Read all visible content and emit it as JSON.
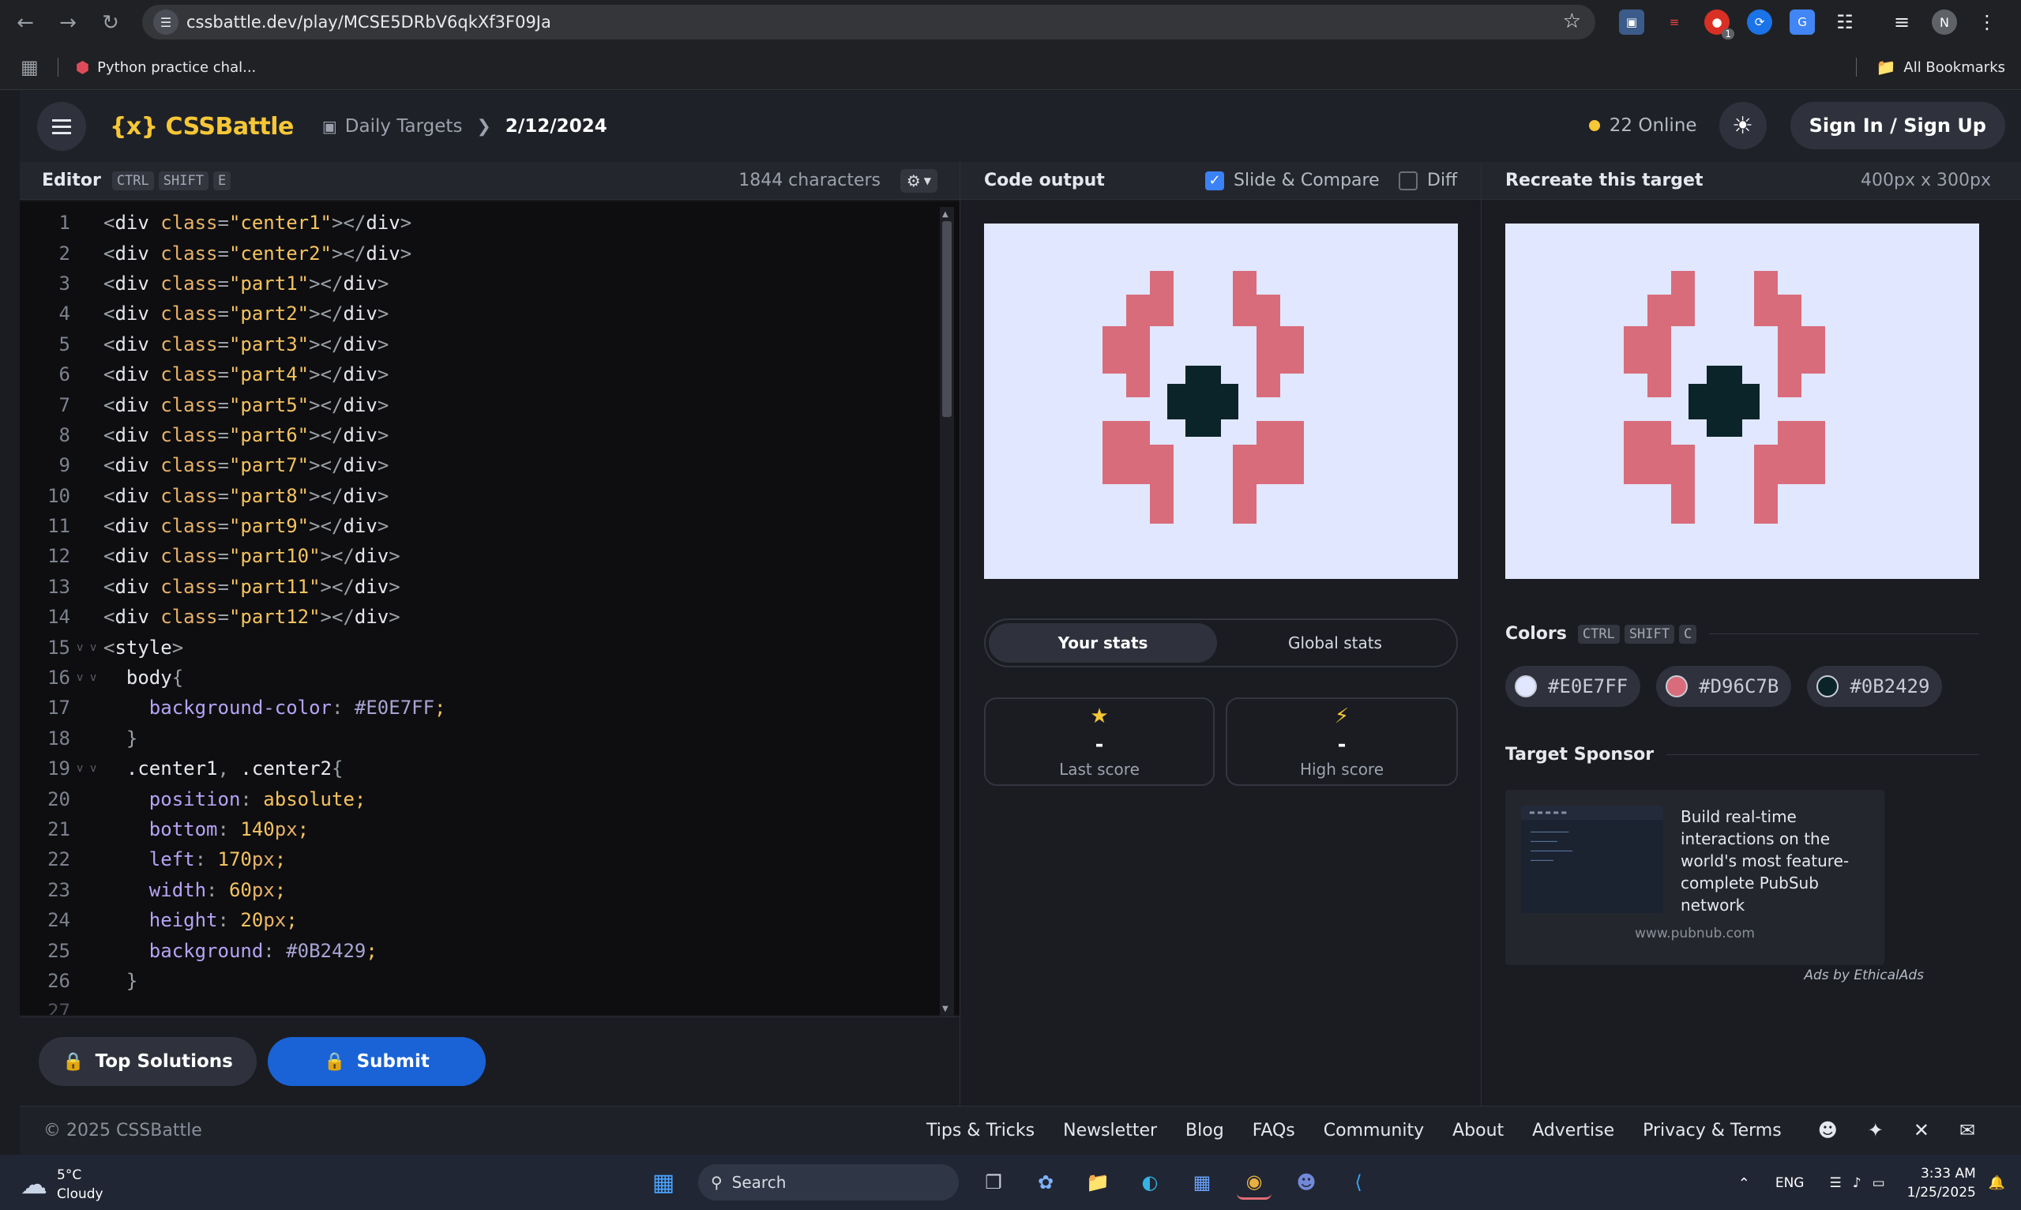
{
  "browser": {
    "url": "cssbattle.dev/play/MCSE5DRbV6qkXf3F09Ja",
    "bookmark_python": "Python practice chal...",
    "all_bookmarks": "All Bookmarks",
    "avatar_letter": "N",
    "ext_badge": "1"
  },
  "app": {
    "logo": "{x} CSSBattle",
    "crumb_daily": "Daily Targets",
    "crumb_date": "2/12/2024",
    "online": "22 Online",
    "signin": "Sign In / Sign Up"
  },
  "editor": {
    "title": "Editor",
    "keys": [
      "CTRL",
      "SHIFT",
      "E"
    ],
    "chars": "1844 characters",
    "last_line": "27"
  },
  "code_lines": [
    {
      "n": "1",
      "html": "<span class=tg>&lt;</span><span class=tn>div </span><span class=at>class</span><span class=tg>=</span><span class=st>\"center1\"</span><span class=tg>&gt;&lt;/</span><span class=tn>div</span><span class=tg>&gt;</span>"
    },
    {
      "n": "2",
      "html": "<span class=tg>&lt;</span><span class=tn>div </span><span class=at>class</span><span class=tg>=</span><span class=st>\"center2\"</span><span class=tg>&gt;&lt;/</span><span class=tn>div</span><span class=tg>&gt;</span>"
    },
    {
      "n": "3",
      "html": "<span class=tg>&lt;</span><span class=tn>div </span><span class=at>class</span><span class=tg>=</span><span class=st>\"part1\"</span><span class=tg>&gt;&lt;/</span><span class=tn>div</span><span class=tg>&gt;</span>"
    },
    {
      "n": "4",
      "html": "<span class=tg>&lt;</span><span class=tn>div </span><span class=at>class</span><span class=tg>=</span><span class=st>\"part2\"</span><span class=tg>&gt;&lt;/</span><span class=tn>div</span><span class=tg>&gt;</span>"
    },
    {
      "n": "5",
      "html": "<span class=tg>&lt;</span><span class=tn>div </span><span class=at>class</span><span class=tg>=</span><span class=st>\"part3\"</span><span class=tg>&gt;&lt;/</span><span class=tn>div</span><span class=tg>&gt;</span>"
    },
    {
      "n": "6",
      "html": "<span class=tg>&lt;</span><span class=tn>div </span><span class=at>class</span><span class=tg>=</span><span class=st>\"part4\"</span><span class=tg>&gt;&lt;/</span><span class=tn>div</span><span class=tg>&gt;</span>"
    },
    {
      "n": "7",
      "html": "<span class=tg>&lt;</span><span class=tn>div </span><span class=at>class</span><span class=tg>=</span><span class=st>\"part5\"</span><span class=tg>&gt;&lt;/</span><span class=tn>div</span><span class=tg>&gt;</span>"
    },
    {
      "n": "8",
      "html": "<span class=tg>&lt;</span><span class=tn>div </span><span class=at>class</span><span class=tg>=</span><span class=st>\"part6\"</span><span class=tg>&gt;&lt;/</span><span class=tn>div</span><span class=tg>&gt;</span>"
    },
    {
      "n": "9",
      "html": "<span class=tg>&lt;</span><span class=tn>div </span><span class=at>class</span><span class=tg>=</span><span class=st>\"part7\"</span><span class=tg>&gt;&lt;/</span><span class=tn>div</span><span class=tg>&gt;</span>"
    },
    {
      "n": "10",
      "html": "<span class=tg>&lt;</span><span class=tn>div </span><span class=at>class</span><span class=tg>=</span><span class=st>\"part8\"</span><span class=tg>&gt;&lt;/</span><span class=tn>div</span><span class=tg>&gt;</span>"
    },
    {
      "n": "11",
      "html": "<span class=tg>&lt;</span><span class=tn>div </span><span class=at>class</span><span class=tg>=</span><span class=st>\"part9\"</span><span class=tg>&gt;&lt;/</span><span class=tn>div</span><span class=tg>&gt;</span>"
    },
    {
      "n": "12",
      "html": "<span class=tg>&lt;</span><span class=tn>div </span><span class=at>class</span><span class=tg>=</span><span class=st>\"part10\"</span><span class=tg>&gt;&lt;/</span><span class=tn>div</span><span class=tg>&gt;</span>"
    },
    {
      "n": "13",
      "html": "<span class=tg>&lt;</span><span class=tn>div </span><span class=at>class</span><span class=tg>=</span><span class=st>\"part11\"</span><span class=tg>&gt;&lt;/</span><span class=tn>div</span><span class=tg>&gt;</span>"
    },
    {
      "n": "14",
      "html": "<span class=tg>&lt;</span><span class=tn>div </span><span class=at>class</span><span class=tg>=</span><span class=st>\"part12\"</span><span class=tg>&gt;&lt;/</span><span class=tn>div</span><span class=tg>&gt;</span>"
    },
    {
      "n": "15",
      "fold": "v v",
      "html": "<span class=tg>&lt;</span><span class=tn>style</span><span class=tg>&gt;</span>"
    },
    {
      "n": "16",
      "fold": "v v",
      "html": "  <span class=tn>body</span><span class=tg>{</span>"
    },
    {
      "n": "17",
      "html": "    <span class=pr>background-color</span><span class=tg>: </span><span class=hx>#E0E7FF</span><span class=st>;</span>"
    },
    {
      "n": "18",
      "html": "  <span class=tg>}</span>"
    },
    {
      "n": "19",
      "fold": "v v",
      "html": "  <span class=sl>.center1</span><span class=tg>, </span><span class=sl>.center2</span><span class=tg>{</span>"
    },
    {
      "n": "20",
      "html": "    <span class=pr>position</span><span class=tg>: </span><span class=nm>absolute</span><span class=st>;</span>"
    },
    {
      "n": "21",
      "html": "    <span class=pr>bottom</span><span class=tg>: </span><span class=nm>140</span><span class=un>px</span><span class=st>;</span>"
    },
    {
      "n": "22",
      "html": "    <span class=pr>left</span><span class=tg>: </span><span class=nm>170</span><span class=un>px</span><span class=st>;</span>"
    },
    {
      "n": "23",
      "html": "    <span class=pr>width</span><span class=tg>: </span><span class=nm>60</span><span class=un>px</span><span class=st>;</span>"
    },
    {
      "n": "24",
      "html": "    <span class=pr>height</span><span class=tg>: </span><span class=nm>20</span><span class=un>px</span><span class=st>;</span>"
    },
    {
      "n": "25",
      "html": "    <span class=pr>background</span><span class=tg>: </span><span class=hx>#0B2429</span><span class=st>;</span>"
    },
    {
      "n": "26",
      "html": "  <span class=tg>}</span>"
    }
  ],
  "output": {
    "title": "Code output",
    "slide_compare": "Slide & Compare",
    "diff": "Diff",
    "tab_your": "Your stats",
    "tab_global": "Global stats",
    "last_value": "-",
    "last_label": "Last score",
    "high_value": "-",
    "high_label": "High score"
  },
  "target": {
    "title": "Recreate this target",
    "size": "400px x 300px",
    "colors_title": "Colors",
    "colors_keys": [
      "CTRL",
      "SHIFT",
      "C"
    ],
    "colors": [
      {
        "hex": "#E0E7FF",
        "label": "#E0E7FF"
      },
      {
        "hex": "#D96C7B",
        "label": "#D96C7B"
      },
      {
        "hex": "#0B2429",
        "label": "#0B2429"
      }
    ],
    "sponsor_title": "Target Sponsor",
    "sponsor_text": "Build real-time interactions on the world's most feature-complete PubSub network",
    "sponsor_url": "www.pubnub.com",
    "ads_by": "Ads by EthicalAds"
  },
  "buttons": {
    "top_solutions": "Top Solutions",
    "submit": "Submit"
  },
  "footer": {
    "copyright": "© 2025 CSSBattle",
    "links": [
      "Tips & Tricks",
      "Newsletter",
      "Blog",
      "FAQs",
      "Community",
      "About",
      "Advertise",
      "Privacy & Terms"
    ]
  },
  "taskbar": {
    "weather_temp": "5°C",
    "weather_desc": "Cloudy",
    "search": "Search",
    "lang": "ENG",
    "time": "3:33 AM",
    "date": "1/25/2025"
  },
  "colors": {
    "accent_yellow": "#F6C736",
    "submit_blue": "#1A63D6",
    "pink": "#D96C7B",
    "dark": "#0B2429",
    "canvas_bg": "#E0E7FF"
  }
}
